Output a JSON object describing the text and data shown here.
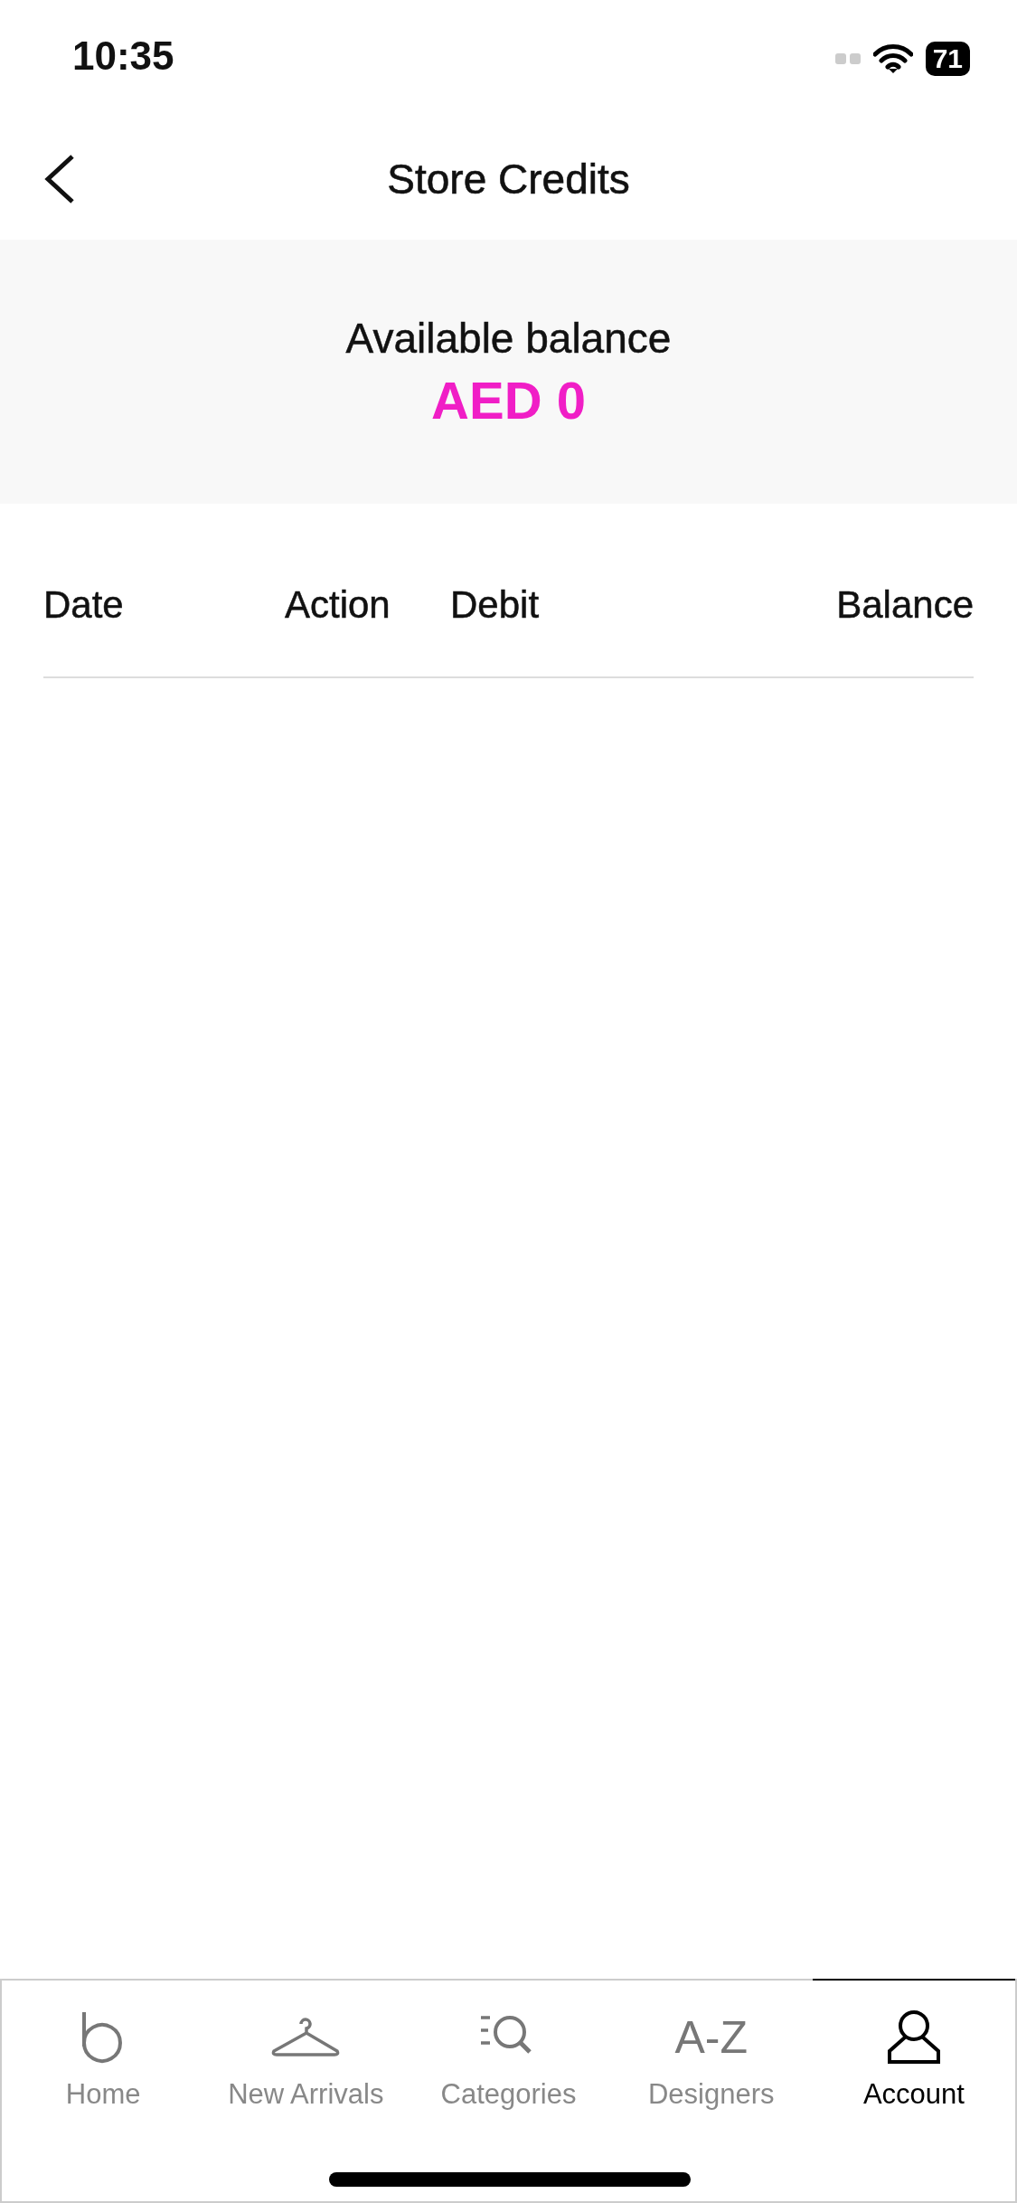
{
  "status_bar": {
    "time": "10:35",
    "battery": "71"
  },
  "header": {
    "title": "Store Credits"
  },
  "balance": {
    "label": "Available balance",
    "amount": "AED 0"
  },
  "table": {
    "columns": [
      "Date",
      "Action",
      "Debit",
      "Balance"
    ]
  },
  "tab_bar": [
    {
      "kind": "home",
      "label": "Home",
      "selected": false
    },
    {
      "kind": "hanger",
      "label": "New Arrivals",
      "selected": false
    },
    {
      "kind": "categories",
      "label": "Categories",
      "selected": false
    },
    {
      "kind": "text",
      "icon_text": "A-Z",
      "label": "Designers",
      "selected": false
    },
    {
      "kind": "person",
      "label": "Account",
      "selected": true
    }
  ]
}
